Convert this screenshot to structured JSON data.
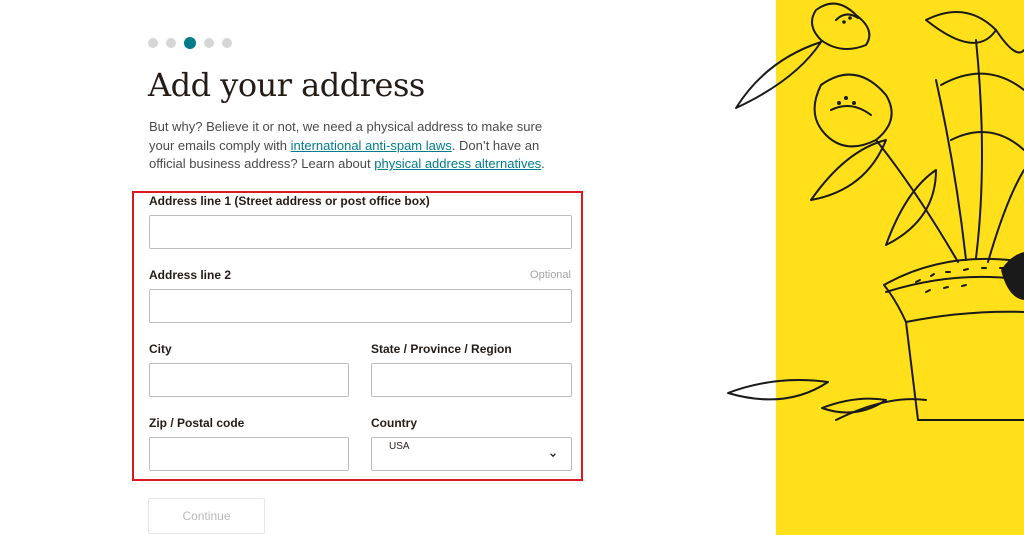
{
  "progress": {
    "total_steps": 5,
    "current_step": 3
  },
  "header": {
    "title": "Add your address"
  },
  "intro": {
    "text_before": "But why? Believe it or not, we need a physical address to make sure your emails comply with ",
    "link1": "international anti-spam laws",
    "text_middle": ". Don’t have an official business address? Learn about ",
    "link2": "physical address alternatives",
    "text_after": "."
  },
  "form": {
    "address1": {
      "label": "Address line 1 (Street address or post office box)",
      "value": ""
    },
    "address2": {
      "label": "Address line 2",
      "optional": "Optional",
      "value": ""
    },
    "city": {
      "label": "City",
      "value": ""
    },
    "state": {
      "label": "State / Province / Region",
      "value": ""
    },
    "zip": {
      "label": "Zip / Postal code",
      "value": ""
    },
    "country": {
      "label": "Country",
      "value": "USA"
    }
  },
  "continue_label": "Continue",
  "colors": {
    "accent": "#007c89",
    "highlight": "#e0171f",
    "panel": "#ffe01b"
  },
  "illustration": {
    "icon": "potted-plant-illustration"
  }
}
